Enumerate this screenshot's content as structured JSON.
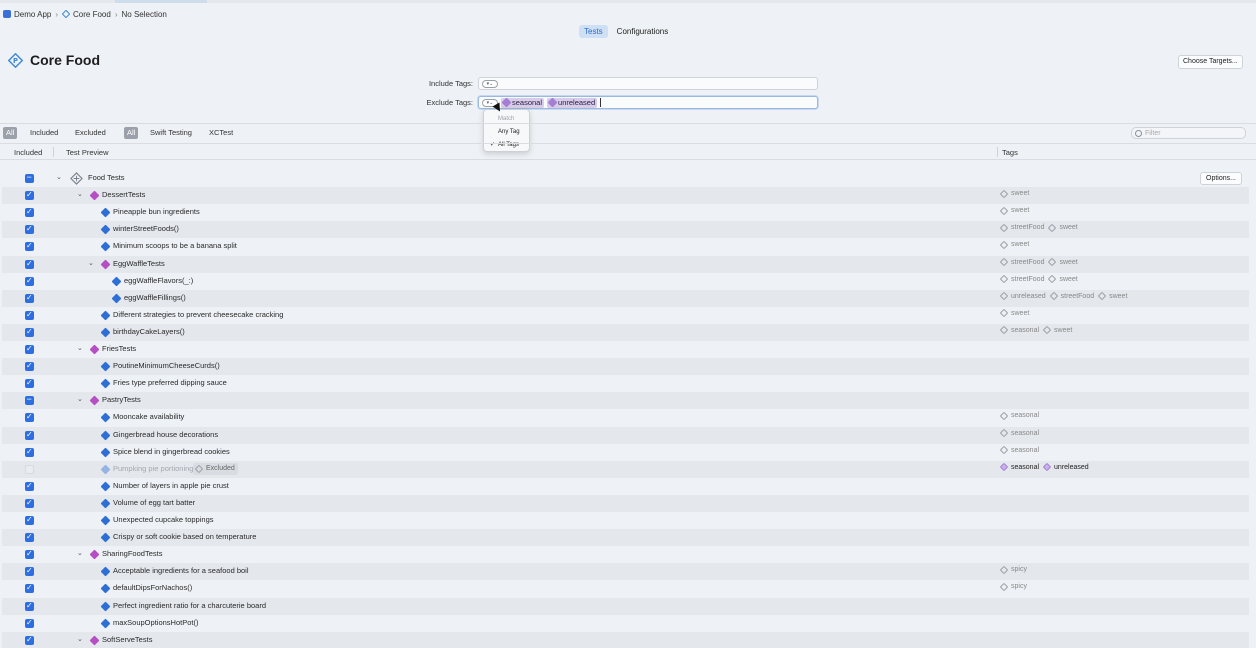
{
  "breadcrumb": [
    "Demo App",
    "Core Food",
    "No Selection"
  ],
  "segments": [
    "Tests",
    "Configurations"
  ],
  "page_title": "Core Food",
  "choose_targets": "Choose Targets...",
  "include_tags_label": "Include Tags:",
  "exclude_tags_label": "Exclude Tags:",
  "exclude_tokens": [
    "seasonal",
    "unreleased"
  ],
  "dropdown": {
    "header": "Match",
    "items": [
      "Any Tag",
      "All Tags"
    ],
    "checked": "All Tags"
  },
  "filter_pills": [
    "All",
    "Included",
    "Excluded",
    "All",
    "Swift Testing",
    "XCTest"
  ],
  "filter_placeholder": "Filter",
  "columns": {
    "included": "Included",
    "test": "Test Preview",
    "tags": "Tags"
  },
  "options_label": "Options...",
  "excluded_label": "Excluded",
  "rows": [
    {
      "label": "Food Tests",
      "kind": "plan",
      "check": "mixed",
      "tags": []
    },
    {
      "label": "DessertTests",
      "kind": "suite",
      "check": "on",
      "tags": [
        "sweet"
      ]
    },
    {
      "label": "Pineapple bun ingredients",
      "kind": "test",
      "check": "on",
      "tags": [
        "sweet"
      ]
    },
    {
      "label": "winterStreetFoods()",
      "kind": "test",
      "check": "on",
      "tags": [
        "streetFood",
        "sweet"
      ]
    },
    {
      "label": "Minimum scoops to be a banana split",
      "kind": "test",
      "check": "on",
      "tags": [
        "sweet"
      ]
    },
    {
      "label": "EggWaffleTests",
      "kind": "suite",
      "check": "on",
      "tags": [
        "streetFood",
        "sweet"
      ]
    },
    {
      "label": "eggWaffleFlavors(_:)",
      "kind": "test",
      "check": "on",
      "tags": [
        "streetFood",
        "sweet"
      ]
    },
    {
      "label": "eggWaffleFillings()",
      "kind": "test",
      "check": "on",
      "tags": [
        "unreleased",
        "streetFood",
        "sweet"
      ]
    },
    {
      "label": "Different strategies to prevent cheesecake cracking",
      "kind": "test",
      "check": "on",
      "tags": [
        "sweet"
      ]
    },
    {
      "label": "birthdayCakeLayers()",
      "kind": "test",
      "check": "on",
      "tags": [
        "seasonal",
        "sweet"
      ]
    },
    {
      "label": "FriesTests",
      "kind": "suite",
      "check": "on",
      "tags": []
    },
    {
      "label": "PoutineMinimumCheeseCurds()",
      "kind": "test",
      "check": "on",
      "tags": []
    },
    {
      "label": "Fries type preferred dipping sauce",
      "kind": "test",
      "check": "on",
      "tags": []
    },
    {
      "label": "PastryTests",
      "kind": "suite",
      "check": "mixed",
      "tags": []
    },
    {
      "label": "Mooncake availability",
      "kind": "test",
      "check": "on",
      "tags": [
        "seasonal"
      ]
    },
    {
      "label": "Gingerbread house decorations",
      "kind": "test",
      "check": "on",
      "tags": [
        "seasonal"
      ]
    },
    {
      "label": "Spice blend in gingerbread cookies",
      "kind": "test",
      "check": "on",
      "tags": [
        "seasonal"
      ]
    },
    {
      "label": "Pumpking pie portioning",
      "kind": "test",
      "check": "off",
      "excluded": true,
      "tags": [
        "seasonal",
        "unreleased"
      ]
    },
    {
      "label": "Number of layers in apple pie crust",
      "kind": "test",
      "check": "on",
      "tags": []
    },
    {
      "label": "Volume of egg tart batter",
      "kind": "test",
      "check": "on",
      "tags": []
    },
    {
      "label": "Unexpected cupcake toppings",
      "kind": "test",
      "check": "on",
      "tags": []
    },
    {
      "label": "Crispy or soft cookie based on temperature",
      "kind": "test",
      "check": "on",
      "tags": []
    },
    {
      "label": "SharingFoodTests",
      "kind": "suite",
      "check": "on",
      "tags": []
    },
    {
      "label": "Acceptable ingredients for a seafood boil",
      "kind": "test",
      "check": "on",
      "tags": [
        "spicy"
      ]
    },
    {
      "label": "defaultDipsForNachos()",
      "kind": "test",
      "check": "on",
      "tags": [
        "spicy"
      ]
    },
    {
      "label": "Perfect ingredient ratio for a charcuterie board",
      "kind": "test",
      "check": "on",
      "tags": []
    },
    {
      "label": "maxSoupOptionsHotPot()",
      "kind": "test",
      "check": "on",
      "tags": []
    },
    {
      "label": "SoftServeTests",
      "kind": "suite",
      "check": "on",
      "tags": []
    }
  ]
}
